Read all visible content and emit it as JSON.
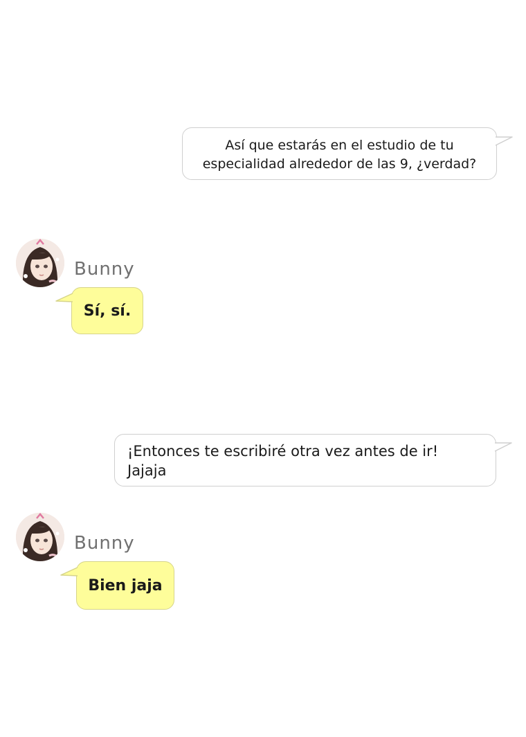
{
  "colors": {
    "page_bg": "#ffffff",
    "outgoing_bubble": "#ffffff",
    "incoming_bubble": "#fefd9a",
    "bubble_border": "#cfcfcf"
  },
  "messages": [
    {
      "direction": "outgoing",
      "text": "Así que estarás en el estudio de tu\nespecialidad alrededor de las 9, ¿verdad?"
    },
    {
      "direction": "incoming",
      "sender": "Bunny",
      "avatar_icon": "girl-avatar-icon",
      "text": "Sí, sí."
    },
    {
      "direction": "outgoing",
      "text": "¡Entonces te escribiré otra vez antes de ir!\nJajaja"
    },
    {
      "direction": "incoming",
      "sender": "Bunny",
      "avatar_icon": "girl-avatar-icon",
      "text": "Bien jaja"
    }
  ]
}
